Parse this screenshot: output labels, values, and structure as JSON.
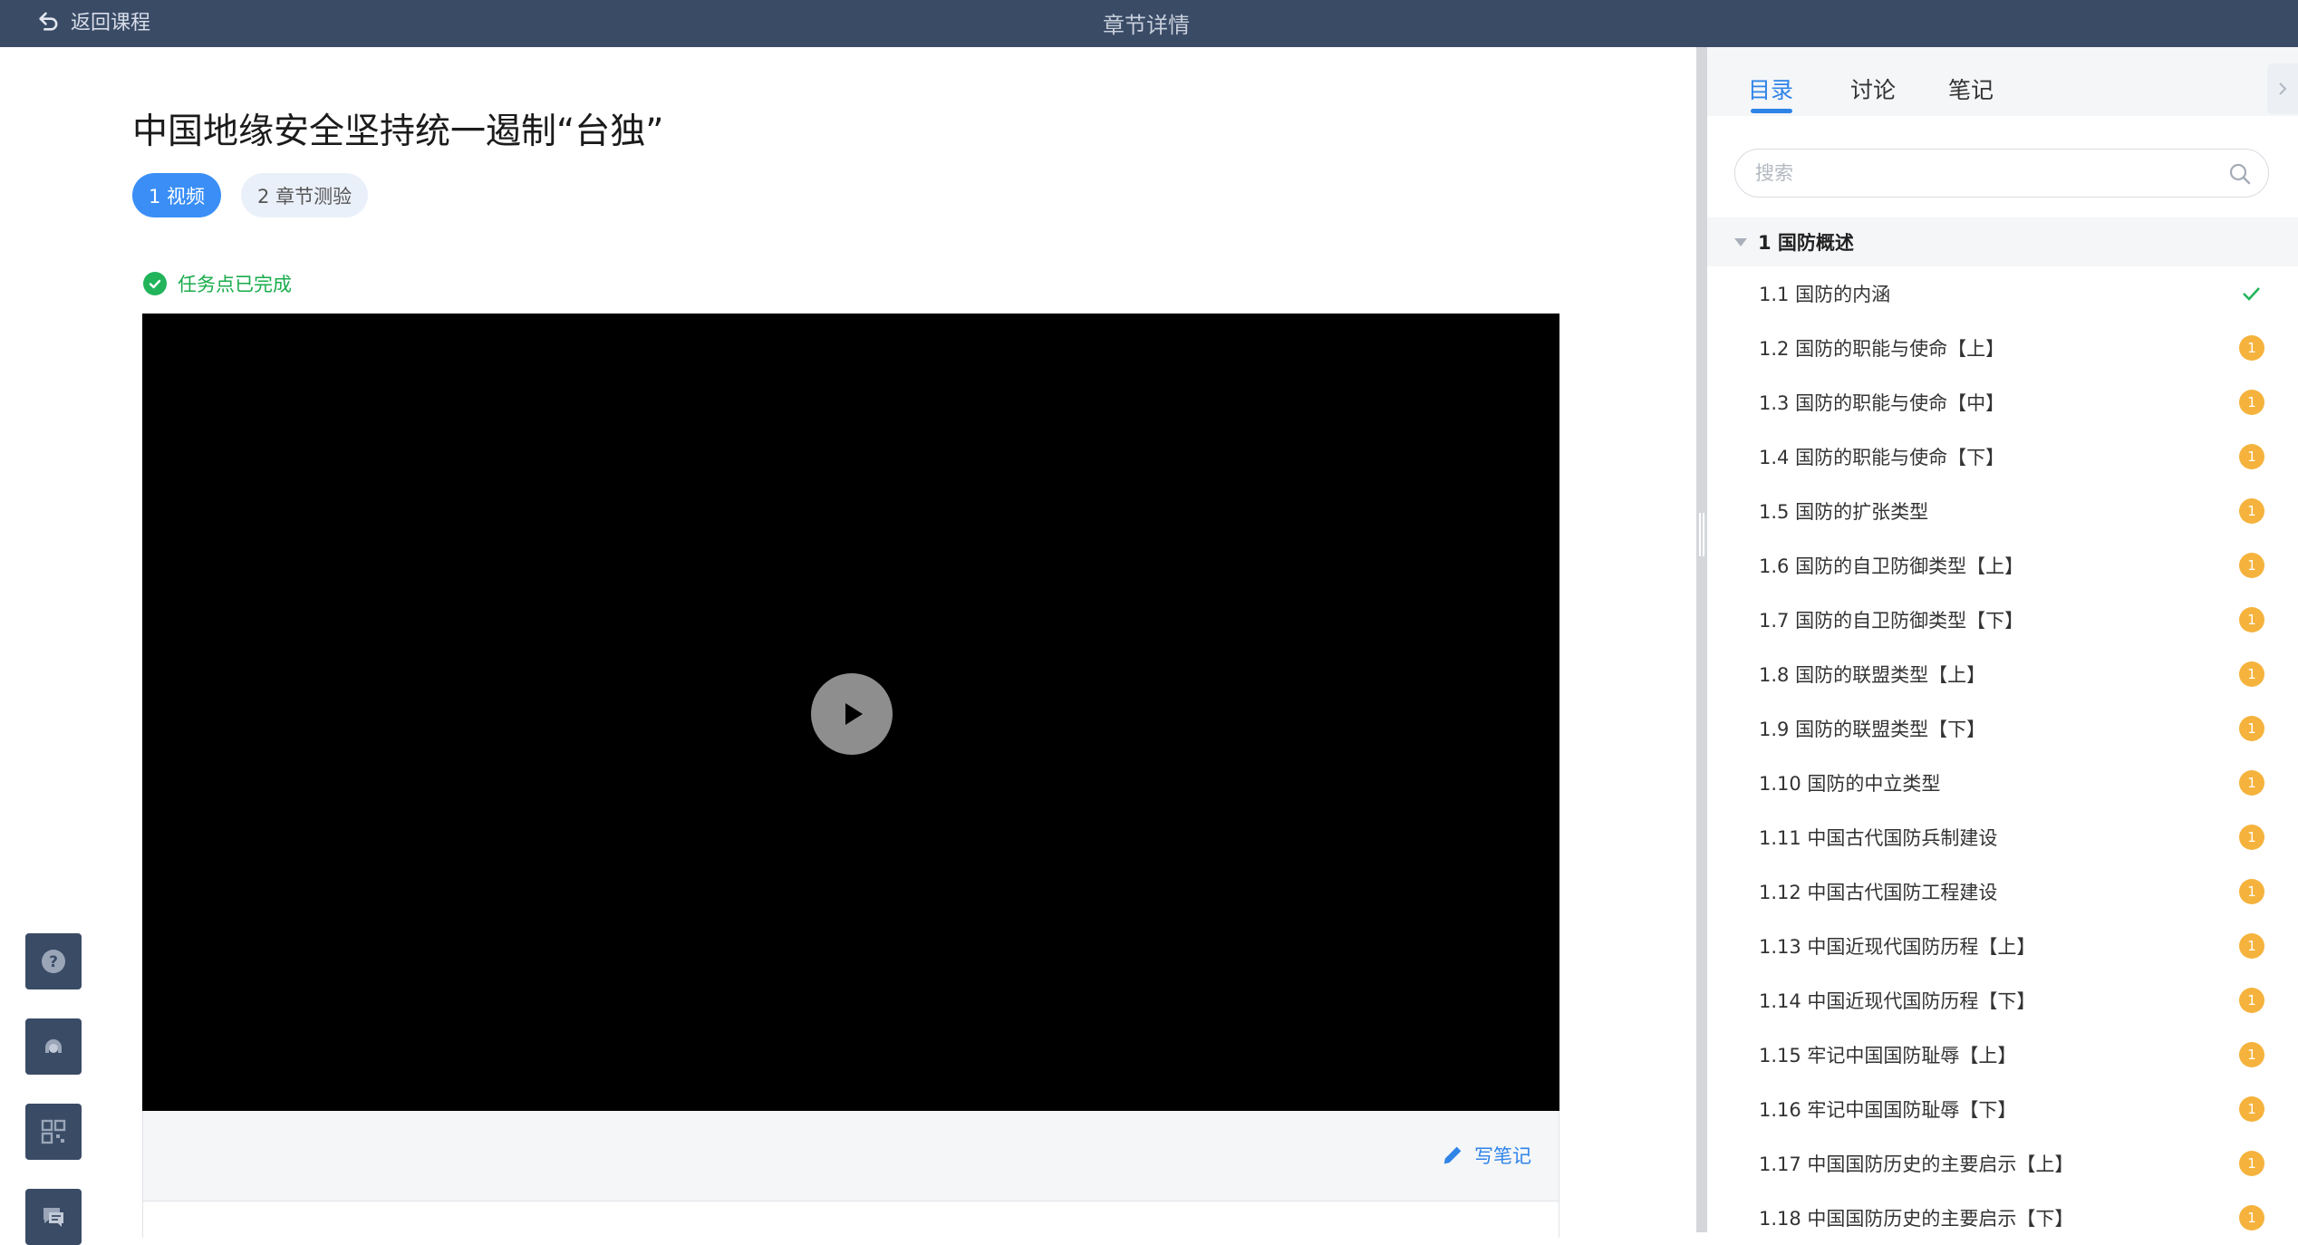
{
  "topbar": {
    "back_label": "返回课程",
    "title": "章节详情"
  },
  "main": {
    "chapter_title": "中国地缘安全坚持统一遏制“台独”",
    "tabs": [
      {
        "label": "1 视频",
        "active": true
      },
      {
        "label": "2 章节测验",
        "active": false
      }
    ],
    "task_status": "任务点已完成",
    "write_note_label": "写笔记"
  },
  "float_buttons": [
    "help-icon",
    "customer-service-icon",
    "qr-code-icon",
    "feedback-icon"
  ],
  "sidebar": {
    "tabs": [
      "目录",
      "讨论",
      "笔记"
    ],
    "active_tab": "目录",
    "search_placeholder": "搜索",
    "section": "1 国防概述",
    "items": [
      {
        "label": "1.1 国防的内涵",
        "status": "done"
      },
      {
        "label": "1.2 国防的职能与使命【上】",
        "status": "pending",
        "badge": "1"
      },
      {
        "label": "1.3 国防的职能与使命【中】",
        "status": "pending",
        "badge": "1"
      },
      {
        "label": "1.4 国防的职能与使命【下】",
        "status": "pending",
        "badge": "1"
      },
      {
        "label": "1.5 国防的扩张类型",
        "status": "pending",
        "badge": "1"
      },
      {
        "label": "1.6 国防的自卫防御类型【上】",
        "status": "pending",
        "badge": "1"
      },
      {
        "label": "1.7 国防的自卫防御类型【下】",
        "status": "pending",
        "badge": "1"
      },
      {
        "label": "1.8 国防的联盟类型【上】",
        "status": "pending",
        "badge": "1"
      },
      {
        "label": "1.9 国防的联盟类型【下】",
        "status": "pending",
        "badge": "1"
      },
      {
        "label": "1.10 国防的中立类型",
        "status": "pending",
        "badge": "1"
      },
      {
        "label": "1.11 中国古代国防兵制建设",
        "status": "pending",
        "badge": "1"
      },
      {
        "label": "1.12 中国古代国防工程建设",
        "status": "pending",
        "badge": "1"
      },
      {
        "label": "1.13 中国近现代国防历程【上】",
        "status": "pending",
        "badge": "1"
      },
      {
        "label": "1.14 中国近现代国防历程【下】",
        "status": "pending",
        "badge": "1"
      },
      {
        "label": "1.15 牢记中国国防耻辱【上】",
        "status": "pending",
        "badge": "1"
      },
      {
        "label": "1.16 牢记中国国防耻辱【下】",
        "status": "pending",
        "badge": "1"
      },
      {
        "label": "1.17 中国国防历史的主要启示【上】",
        "status": "pending",
        "badge": "1"
      },
      {
        "label": "1.18 中国国防历史的主要启示【下】",
        "status": "pending",
        "badge": "1"
      }
    ]
  },
  "colors": {
    "topbar": "#3a4b66",
    "accent": "#3a8ef5",
    "done": "#22b45a",
    "badge": "#f5b33d"
  }
}
